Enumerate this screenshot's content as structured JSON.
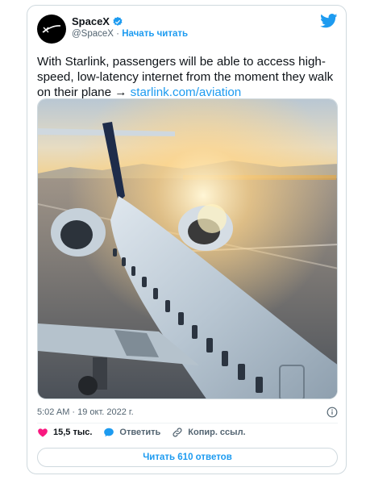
{
  "tweet": {
    "author_name": "SpaceX",
    "handle": "@SpaceX",
    "separator": "·",
    "follow_label": "Начать читать",
    "text_main": "With Starlink, passengers will be able to access high-speed, low-latency internet from the moment they walk on their plane → ",
    "link_text": "starlink.com/aviation",
    "timestamp": "5:02 AM · 19 окт. 2022 г.",
    "likes": "15,5 тыс.",
    "reply_label": "Ответить",
    "copy_link_label": "Копир. ссыл.",
    "read_replies_label": "Читать 610 ответов"
  },
  "colors": {
    "accent": "#1d9bf0",
    "like": "#f91880",
    "text": "#0f1419",
    "secondary": "#536471"
  },
  "icons": {
    "verified": "verified-badge-icon",
    "brand": "twitter-bird-icon",
    "info": "info-icon",
    "like": "heart-icon",
    "reply": "reply-bubble-icon",
    "copy": "link-icon"
  }
}
